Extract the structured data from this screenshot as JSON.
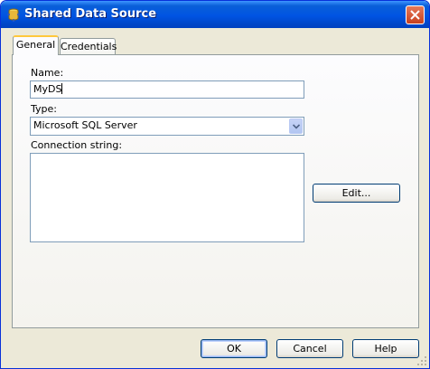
{
  "window": {
    "title": "Shared Data Source"
  },
  "tabs": [
    {
      "label": "General",
      "active": true
    },
    {
      "label": "Credentials",
      "active": false
    }
  ],
  "fields": {
    "name": {
      "label": "Name:",
      "value": "MyDS"
    },
    "type": {
      "label": "Type:",
      "value": "Microsoft SQL Server"
    },
    "connection": {
      "label": "Connection string:",
      "value": ""
    }
  },
  "buttons": {
    "edit": "Edit...",
    "ok": "OK",
    "cancel": "Cancel",
    "help": "Help"
  },
  "colors": {
    "titlebar": "#0054e3",
    "dialog_bg": "#ece9d8",
    "input_border": "#7f9db9"
  }
}
